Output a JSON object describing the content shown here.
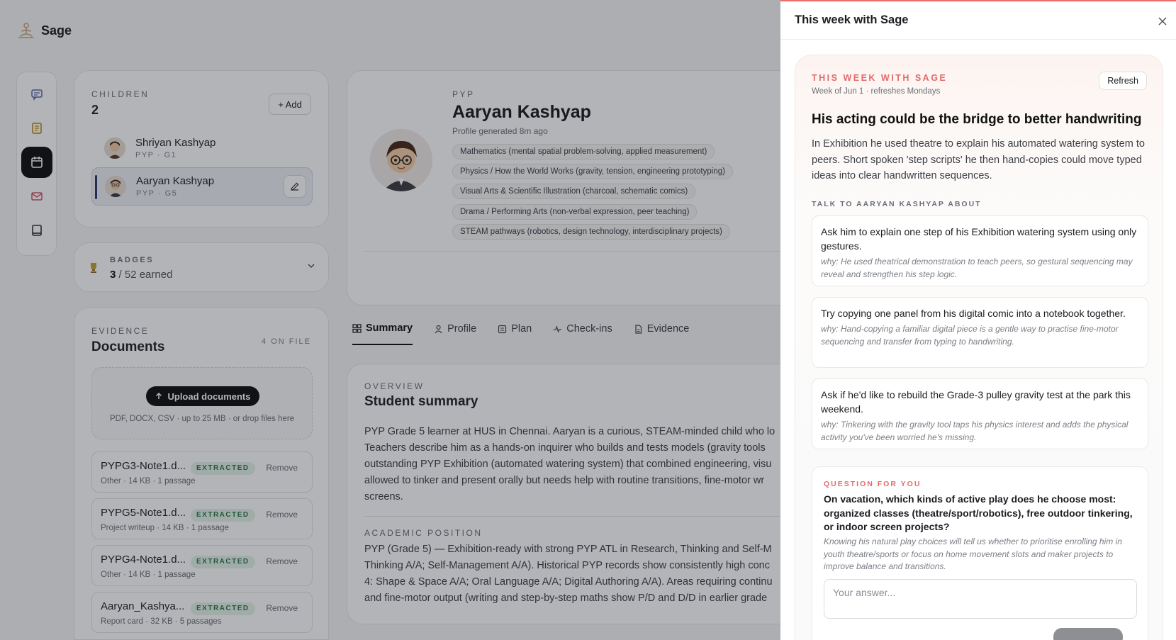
{
  "brand": {
    "name": "Sage"
  },
  "children": {
    "eyebrow": "CHILDREN",
    "count": "2",
    "add_label": "+ Add",
    "items": [
      {
        "name": "Shriyan Kashyap",
        "sub": "PYP · G1"
      },
      {
        "name": "Aaryan Kashyap",
        "sub": "PYP · G5"
      }
    ]
  },
  "badges": {
    "eyebrow": "BADGES",
    "earned": "3",
    "total_text": "/ 52 earned"
  },
  "evidence": {
    "eyebrow": "EVIDENCE",
    "title": "Documents",
    "on_file": "4 ON FILE",
    "upload_label": "Upload documents",
    "hint": "PDF, DOCX, CSV · up to 25 MB · or drop files here",
    "docs": [
      {
        "name": "PYPG3-Note1.d...",
        "tag": "EXTRACTED",
        "remove": "Remove",
        "meta": "Other · 14 KB · 1 passage"
      },
      {
        "name": "PYPG5-Note1.d...",
        "tag": "EXTRACTED",
        "remove": "Remove",
        "meta": "Project writeup · 14 KB · 1 passage"
      },
      {
        "name": "PYPG4-Note1.d...",
        "tag": "EXTRACTED",
        "remove": "Remove",
        "meta": "Other · 14 KB · 1 passage"
      },
      {
        "name": "Aaryan_Kashya...",
        "tag": "EXTRACTED",
        "remove": "Remove",
        "meta": "Report card · 32 KB · 5 passages"
      }
    ]
  },
  "profile": {
    "eyebrow": "PYP",
    "name": "Aaryan Kashyap",
    "generated": "Profile generated 8m ago",
    "interests": [
      "Mathematics (mental spatial problem-solving, applied measurement)",
      "Physics / How the World Works (gravity, tension, engineering prototyping)",
      "Visual Arts & Scientific Illustration (charcoal, schematic comics)",
      "Drama / Performing Arts (non-verbal expression, peer teaching)",
      "STEAM pathways (robotics, design technology, interdisciplinary projects)"
    ]
  },
  "tabs": [
    "Summary",
    "Profile",
    "Plan",
    "Check-ins",
    "Evidence"
  ],
  "summary": {
    "eyebrow": "OVERVIEW",
    "title": "Student summary",
    "lines": [
      "PYP Grade 5 learner at HUS in Chennai. Aaryan is a curious, STEAM-minded child who lo",
      "Teachers describe him as a hands-on inquirer who builds and tests models (gravity tools",
      "outstanding PYP Exhibition (automated watering system) that combined engineering, visu",
      "allowed to tinker and present orally but needs help with routine transitions, fine-motor wr",
      "screens."
    ],
    "eyebrow2": "ACADEMIC POSITION",
    "lines2": [
      "PYP (Grade 5) — Exhibition-ready with strong PYP ATL in Research, Thinking and Self-M",
      "Thinking A/A; Self-Management A/A). Historical PYP records show consistently high conc",
      "4: Shape & Space A/A; Oral Language A/A; Digital Authoring A/A). Areas requiring continu",
      "and fine-motor output (writing and step-by-step maths show P/D and D/D in earlier grade"
    ]
  },
  "drawer": {
    "title": "This week with Sage",
    "eyebrow": "THIS WEEK WITH SAGE",
    "week": "Week of Jun 1 · refreshes Mondays",
    "refresh_label": "Refresh",
    "headline": "His acting could be the bridge to better handwriting",
    "body": "In Exhibition he used theatre to explain his automated watering system to peers. Short spoken 'step scripts' he then hand-copies could move typed ideas into clear handwritten sequences.",
    "talk_eyebrow": "TALK TO AARYAN KASHYAP ABOUT",
    "talk": [
      {
        "text": "Ask him to explain one step of his Exhibition watering system using only gestures.",
        "why": "why: He used theatrical demonstration to teach peers, so gestural sequencing may reveal and strengthen his step logic."
      },
      {
        "text": "Try copying one panel from his digital comic into a notebook together.",
        "why": "why: Hand-copying a familiar digital piece is a gentle way to practise fine-motor sequencing and transfer from typing to handwriting."
      },
      {
        "text": "Ask if he'd like to rebuild the Grade-3 pulley gravity test at the park this weekend.",
        "why": "why: Tinkering with the gravity tool taps his physics interest and adds the physical activity you've been worried he's missing."
      }
    ],
    "question": {
      "eyebrow": "QUESTION FOR YOU",
      "text": "On vacation, which kinds of active play does he choose most: organized classes (theatre/sport/robotics), free outdoor tinkering, or indoor screen projects?",
      "why": "Knowing his natural play choices will tell us whether to prioritise enrolling him in youth theatre/sports or focus on home movement slots and maker projects to improve balance and transitions.",
      "placeholder": "Your answer..."
    }
  }
}
